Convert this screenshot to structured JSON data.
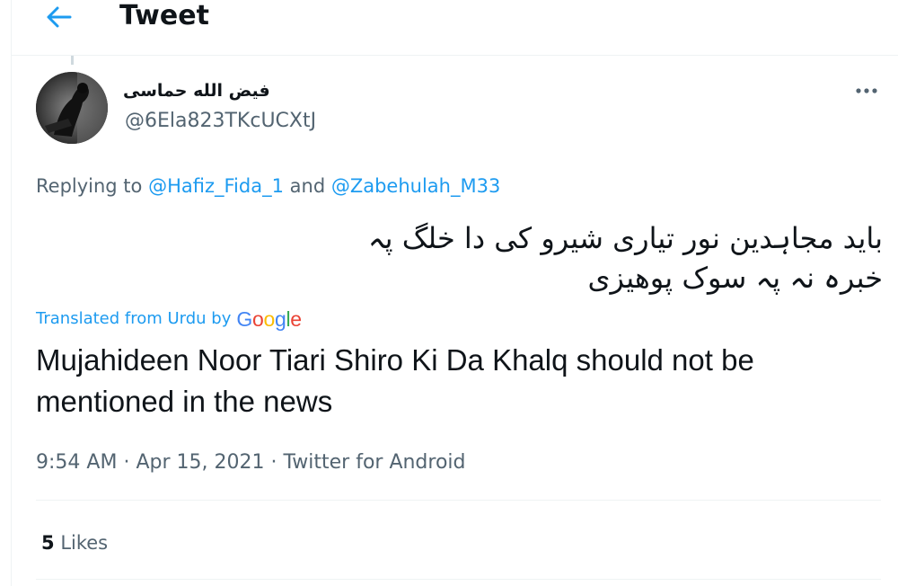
{
  "header": {
    "title": "Tweet",
    "back_icon": "arrow-left-icon"
  },
  "tweet": {
    "author": {
      "display_name": "فیض الله حماسی",
      "handle": "@6Ela823TKcUCXtJ"
    },
    "replying_prefix": "Replying to",
    "replying_to": [
      "@Hafiz_Fida_1",
      "@Zabehulah_M33"
    ],
    "replying_joiner": "and",
    "text": "باید مجاہدین نور تیاری شیرو کی  دا خلگ پہ خبرہ نہ پہ سوک پوهیزی",
    "translated_label": "Translated from Urdu by",
    "translator": "Google",
    "translation": "Mujahideen Noor Tiari Shiro Ki Da Khalq should not be mentioned in the news",
    "time": "9:54 AM",
    "date": "Apr 15, 2021",
    "source": "Twitter for Android",
    "separator": "·",
    "likes_count": "5",
    "likes_label": "Likes"
  },
  "colors": {
    "accent": "#1d9bf0",
    "secondary_text": "#536471",
    "primary_text": "#0f1419",
    "divider": "#eff3f4"
  }
}
